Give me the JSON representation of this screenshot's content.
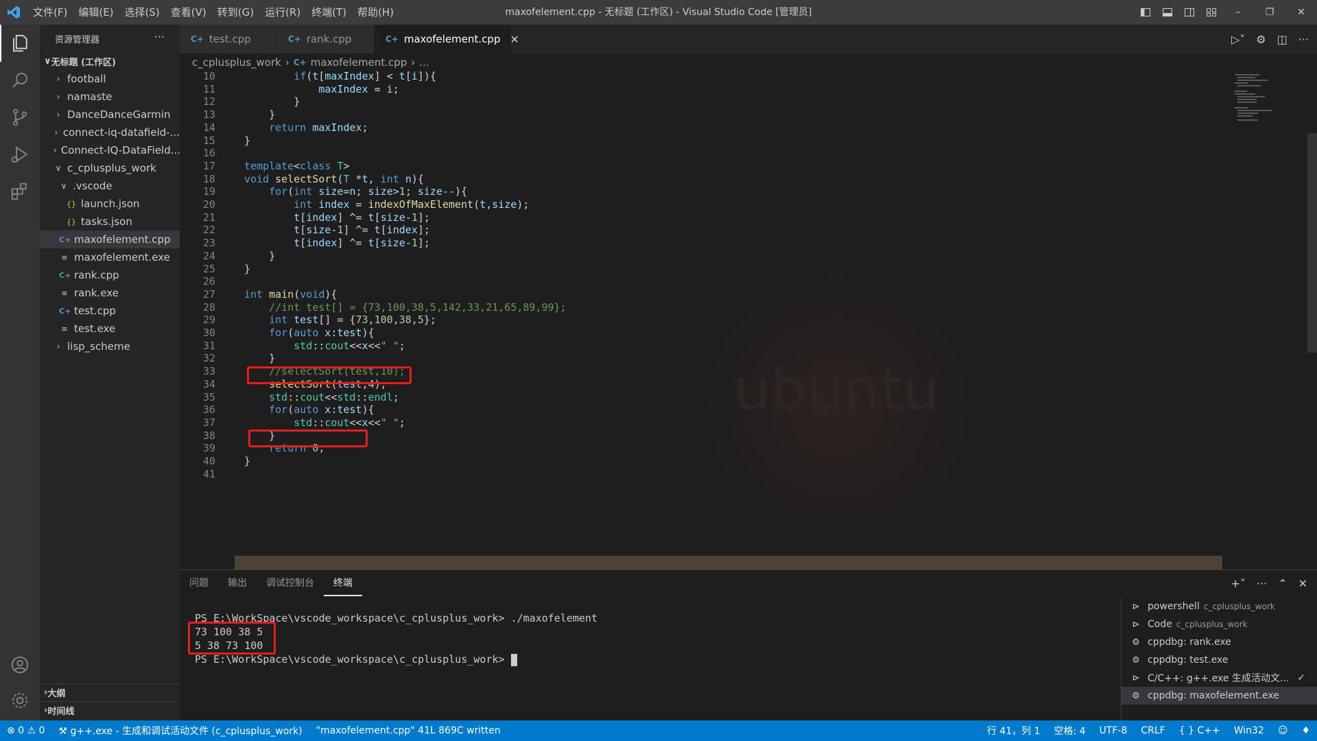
{
  "titlebar": {
    "menus": [
      "文件(F)",
      "编辑(E)",
      "选择(S)",
      "查看(V)",
      "转到(G)",
      "运行(R)",
      "终端(T)",
      "帮助(H)"
    ],
    "title": "maxofelement.cpp - 无标题 (工作区) - Visual Studio Code [管理员]"
  },
  "sidebar": {
    "header": "资源管理器",
    "more": "···",
    "workspace": "无标题 (工作区)",
    "items": [
      {
        "label": "football"
      },
      {
        "label": "namaste"
      },
      {
        "label": "DanceDanceGarmin"
      },
      {
        "label": "connect-iq-datafield-..."
      },
      {
        "label": "Connect-IQ-DataField..."
      },
      {
        "label": "c_cplusplus_work"
      },
      {
        "label": ".vscode"
      },
      {
        "label": "launch.json"
      },
      {
        "label": "tasks.json"
      },
      {
        "label": "maxofelement.cpp"
      },
      {
        "label": "maxofelement.exe"
      },
      {
        "label": "rank.cpp"
      },
      {
        "label": "rank.exe"
      },
      {
        "label": "test.cpp"
      },
      {
        "label": "test.exe"
      },
      {
        "label": "lisp_scheme"
      }
    ],
    "outline": "大纲",
    "timeline": "时间线"
  },
  "tabs": [
    {
      "label": "test.cpp"
    },
    {
      "label": "rank.cpp"
    },
    {
      "label": "maxofelement.cpp"
    }
  ],
  "breadcrumb": {
    "folder": "c_cplusplus_work",
    "file": "maxofelement.cpp",
    "rest": "..."
  },
  "code": {
    "lines": [
      {
        "n": "10",
        "t": "        if(t[maxIndex] < t[i]){"
      },
      {
        "n": "11",
        "t": "            maxIndex = i;"
      },
      {
        "n": "12",
        "t": "        }"
      },
      {
        "n": "13",
        "t": "    }"
      },
      {
        "n": "14",
        "t": "    return maxIndex;"
      },
      {
        "n": "15",
        "t": "}"
      },
      {
        "n": "16",
        "t": ""
      },
      {
        "n": "17",
        "t": "template<class T>"
      },
      {
        "n": "18",
        "t": "void selectSort(T *t, int n){"
      },
      {
        "n": "19",
        "t": "    for(int size=n; size>1; size--){"
      },
      {
        "n": "20",
        "t": "        int index = indexOfMaxElement(t,size);"
      },
      {
        "n": "21",
        "t": "        t[index] ^= t[size-1];"
      },
      {
        "n": "22",
        "t": "        t[size-1] ^= t[index];"
      },
      {
        "n": "23",
        "t": "        t[index] ^= t[size-1];"
      },
      {
        "n": "24",
        "t": "    }"
      },
      {
        "n": "25",
        "t": "}"
      },
      {
        "n": "26",
        "t": ""
      },
      {
        "n": "27",
        "t": "int main(void){"
      },
      {
        "n": "28",
        "t": "    //int test[] = {73,100,38,5,142,33,21,65,89,99};"
      },
      {
        "n": "29",
        "t": "    int test[] = {73,100,38,5};"
      },
      {
        "n": "30",
        "t": "    for(auto x:test){"
      },
      {
        "n": "31",
        "t": "        std::cout<<x<<\" \";"
      },
      {
        "n": "32",
        "t": "    }"
      },
      {
        "n": "33",
        "t": "    //selectSort(test,10);"
      },
      {
        "n": "34",
        "t": "    selectSort(test,4);"
      },
      {
        "n": "35",
        "t": "    std::cout<<std::endl;"
      },
      {
        "n": "36",
        "t": "    for(auto x:test){"
      },
      {
        "n": "37",
        "t": "        std::cout<<x<<\" \";"
      },
      {
        "n": "38",
        "t": "    }"
      },
      {
        "n": "39",
        "t": "    return 0;"
      },
      {
        "n": "40",
        "t": "}"
      },
      {
        "n": "41",
        "t": ""
      }
    ],
    "watermark": "ubuntu"
  },
  "panel": {
    "tabs": [
      "问题",
      "输出",
      "调试控制台",
      "终端"
    ],
    "terminal": [
      "PS E:\\WorkSpace\\vscode_workspace\\c_cplusplus_work> ./maxofelement",
      "73 100 38 5",
      "5 38 73 100",
      "PS E:\\WorkSpace\\vscode_workspace\\c_cplusplus_work> "
    ],
    "terminals": [
      {
        "label": "powershell",
        "sub": "c_cplusplus_work",
        "icon": "terminal-icon"
      },
      {
        "label": "Code",
        "sub": "c_cplusplus_work",
        "icon": "terminal-icon"
      },
      {
        "label": "cppdbg: rank.exe",
        "sub": "",
        "icon": "gear-icon"
      },
      {
        "label": "cppdbg: test.exe",
        "sub": "",
        "icon": "gear-icon"
      },
      {
        "label": "C/C++: g++.exe 生成活动文...",
        "sub": "",
        "icon": "terminal-icon"
      },
      {
        "label": "cppdbg: maxofelement.exe",
        "sub": "",
        "icon": "gear-icon"
      }
    ]
  },
  "statusbar": {
    "errors": "0",
    "warnings": "0",
    "task": "g++.exe - 生成和调试活动文件 (c_cplusplus_work)",
    "message": "\"maxofelement.cpp\" 41L 869C written",
    "position": "行 41，列 1",
    "spaces": "空格: 4",
    "encoding": "UTF-8",
    "eol": "CRLF",
    "language": "C++",
    "platform": "Win32"
  },
  "colors": {
    "accent": "#007acc",
    "highlight_box": "#e81e1e",
    "keyword": "#569cd6",
    "function": "#dcdcaa",
    "string": "#ce9178",
    "number": "#b5cea8",
    "comment": "#6a9955"
  }
}
